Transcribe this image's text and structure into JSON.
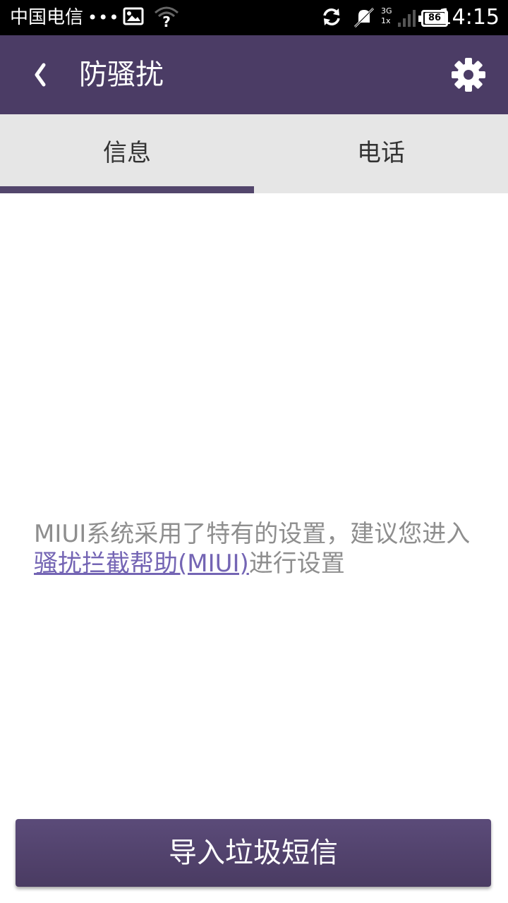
{
  "status_bar": {
    "carrier": "中国电信",
    "dots": "•••",
    "network": [
      "3G",
      "1x"
    ],
    "battery": "86",
    "time": "14:15",
    "icons": [
      "picture-icon",
      "wifi-unknown-icon",
      "sync-icon",
      "mute-icon",
      "signal-icon",
      "battery-icon"
    ]
  },
  "header": {
    "back_icon": "back-chevron-icon",
    "title": "防骚扰",
    "settings_icon": "gear-icon"
  },
  "tabs": [
    {
      "label": "信息",
      "selected": true
    },
    {
      "label": "电话",
      "selected": false
    }
  ],
  "notice": {
    "text_before": "MIUI系统采用了特有的设置，建议您进入",
    "link": "骚扰拦截帮助(MIUI)",
    "text_after": "进行设置"
  },
  "import_button": {
    "label": "导入垃圾短信"
  },
  "colors": {
    "header_bg": "#4b3c65",
    "tab_bg": "#e6e6e6",
    "tab_indicator": "#53466c",
    "link": "#7465b4",
    "notice_text": "#8e8e8e"
  }
}
